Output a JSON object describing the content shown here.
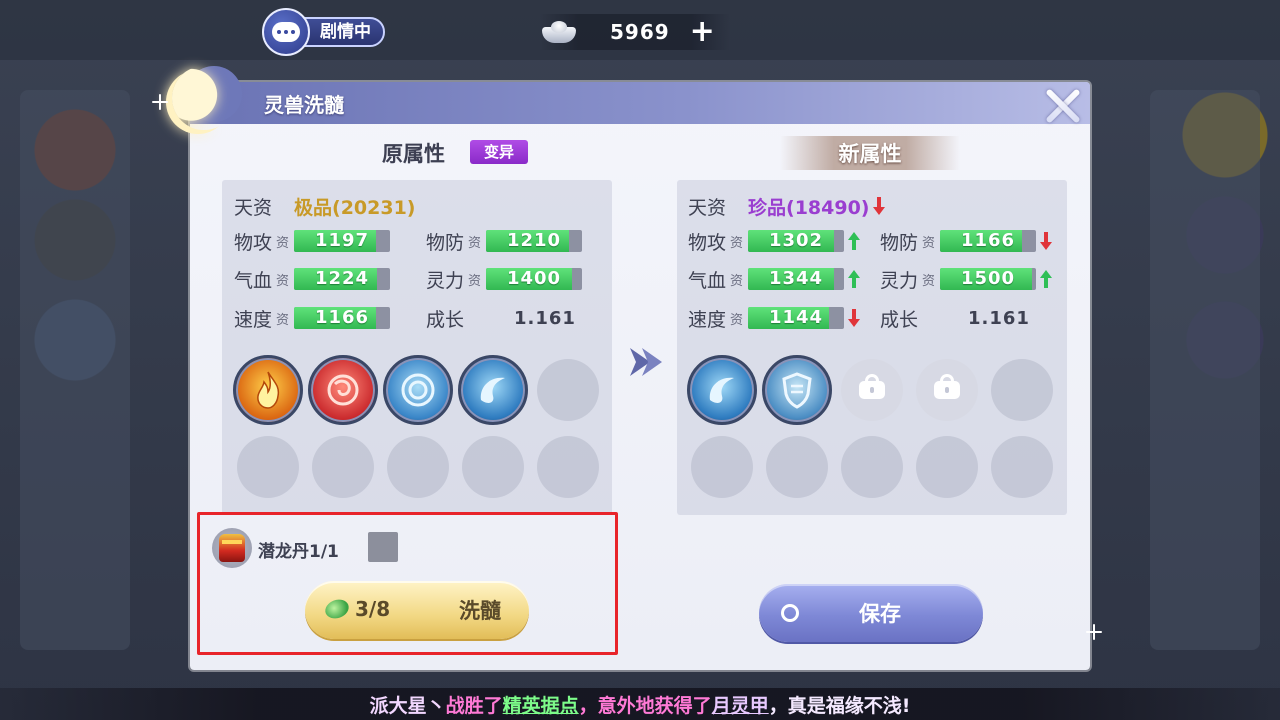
{
  "hud": {
    "story_label": "剧情中",
    "silver_amount": "5969",
    "plus_label": "+"
  },
  "panel": {
    "title": "灵兽洗髓",
    "original_header": "原属性",
    "mutant_badge": "变异",
    "new_header": "新属性"
  },
  "labels": {
    "talent": "天资",
    "attack": "物攻",
    "defense": "物防",
    "hp": "气血",
    "spirit": "灵力",
    "speed": "速度",
    "growth": "成长",
    "zi": "资"
  },
  "original": {
    "talent_value": "极品(20231)",
    "attack": "1197",
    "defense": "1210",
    "hp": "1224",
    "spirit": "1400",
    "speed": "1166",
    "growth": "1.161",
    "attack_fill": 0.85,
    "defense_fill": 0.86,
    "hp_fill": 0.86,
    "spirit_fill": 0.9,
    "speed_fill": 0.85,
    "skills": [
      "fire-skill",
      "red-spirit-skill",
      "blue-ring-skill",
      "water-wave-skill"
    ]
  },
  "new": {
    "talent_value": "珍品(18490)",
    "attack": "1302",
    "defense": "1166",
    "hp": "1344",
    "spirit": "1500",
    "speed": "1144",
    "growth": "1.161",
    "attack_fill": 0.9,
    "defense_fill": 0.85,
    "hp_fill": 0.9,
    "spirit_fill": 0.96,
    "speed_fill": 0.84,
    "talent_trend": "down",
    "attack_trend": "up",
    "defense_trend": "down",
    "hp_trend": "up",
    "spirit_trend": "up",
    "speed_trend": "down",
    "skills": [
      "water-wave-skill",
      "shield-skill"
    ]
  },
  "consumable": {
    "name": "潜龙丹1/1"
  },
  "actions": {
    "wash_cost": "3/8",
    "wash_label": "洗髓",
    "save_label": "保存"
  },
  "message": {
    "name": "派大星丶",
    "p1": "战胜了",
    "place": "精英据点",
    "p2": "，意外地获得了",
    "item": "月灵甲",
    "p3": "，真是福缘不浅!"
  },
  "colors": {
    "accent": "#7e88d6",
    "gold_text": "#c89a28",
    "purple_text": "#9a3ed0",
    "highlight_box": "#e8242a",
    "bar_green": "#32b852"
  }
}
